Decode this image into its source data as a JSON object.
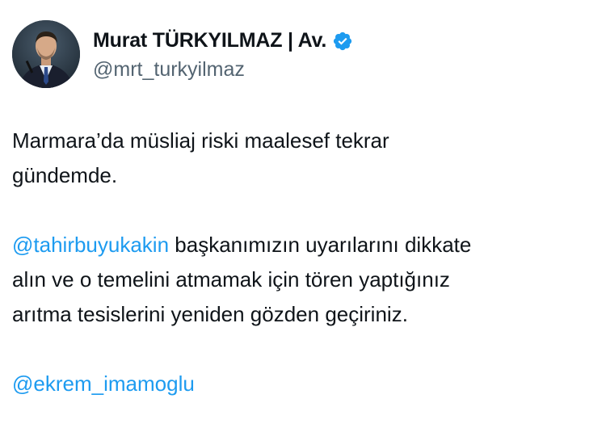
{
  "author": {
    "name": "Murat TÜRKYILMAZ | Av.",
    "handle": "@mrt_turkyilmaz",
    "verified": true,
    "avatar_icon": "profile-photo-man-in-suit",
    "verified_icon": "verified-badge-icon"
  },
  "tweet": {
    "line1": "Marmara’da müsliaj riski maalesef tekrar",
    "line2": "gündemde.",
    "mention1": "@tahirbuyukakin",
    "para2_after_mention": " başkanımızın uyarılarını dikkate",
    "line4": "alın ve o temelini atmamak için tören yaptığınız",
    "line5": "arıtma tesislerini yeniden gözden geçiriniz.",
    "mention2": "@ekrem_imamoglu"
  },
  "colors": {
    "text": "#0f1419",
    "secondary": "#536471",
    "link": "#1d9bf0",
    "verified": "#1d9bf0"
  }
}
